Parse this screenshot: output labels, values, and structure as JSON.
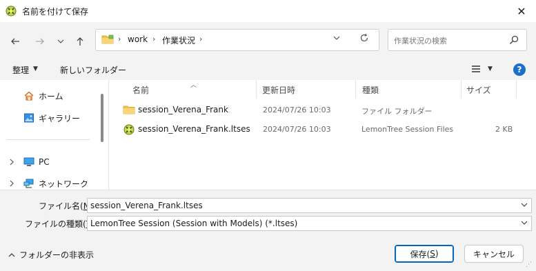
{
  "window": {
    "title": "名前を付けて保存",
    "close_glyph": "✕"
  },
  "address": {
    "segments": [
      "work",
      "作業状況"
    ],
    "separator": "›"
  },
  "search": {
    "placeholder": "作業状況の検索"
  },
  "toolbar": {
    "organize_label": "整理",
    "new_folder_label": "新しいフォルダー",
    "help_label": "?"
  },
  "nav": {
    "quick": [
      {
        "label": "ホーム",
        "icon": "home-icon"
      },
      {
        "label": "ギャラリー",
        "icon": "gallery-icon"
      }
    ],
    "tree": [
      {
        "label": "PC",
        "icon": "pc-icon"
      },
      {
        "label": "ネットワーク",
        "icon": "network-icon"
      }
    ]
  },
  "columns": {
    "name": "名前",
    "modified": "更新日時",
    "type": "種類",
    "size": "サイズ"
  },
  "files": [
    {
      "name": "session_Verena_Frank",
      "modified": "2024/07/26 10:03",
      "type": "ファイル フォルダー",
      "size": "",
      "icon": "folder-icon"
    },
    {
      "name": "session_Verena_Frank.ltses",
      "modified": "2024/07/26 10:03",
      "type": "LemonTree Session Files",
      "size": "2 KB",
      "icon": "lemontree-file-icon"
    }
  ],
  "form": {
    "filename_label_prefix": "ファイル名(",
    "filename_label_key": "N",
    "filename_label_suffix": "):",
    "filename_value": "session_Verena_Frank.ltses",
    "filetype_label_prefix": "ファイルの種類(",
    "filetype_label_key": "T",
    "filetype_label_suffix": "):",
    "filetype_value": "LemonTree Session (Session with Models) (*.ltses)",
    "hide_folders_label": "フォルダーの非表示",
    "save_prefix": "保存(",
    "save_key": "S",
    "save_suffix": ")",
    "cancel_label": "キャンセル"
  },
  "colors": {
    "accent": "#0067c0",
    "folder": "#f2c14e",
    "lemontree": "#9bc31c"
  }
}
